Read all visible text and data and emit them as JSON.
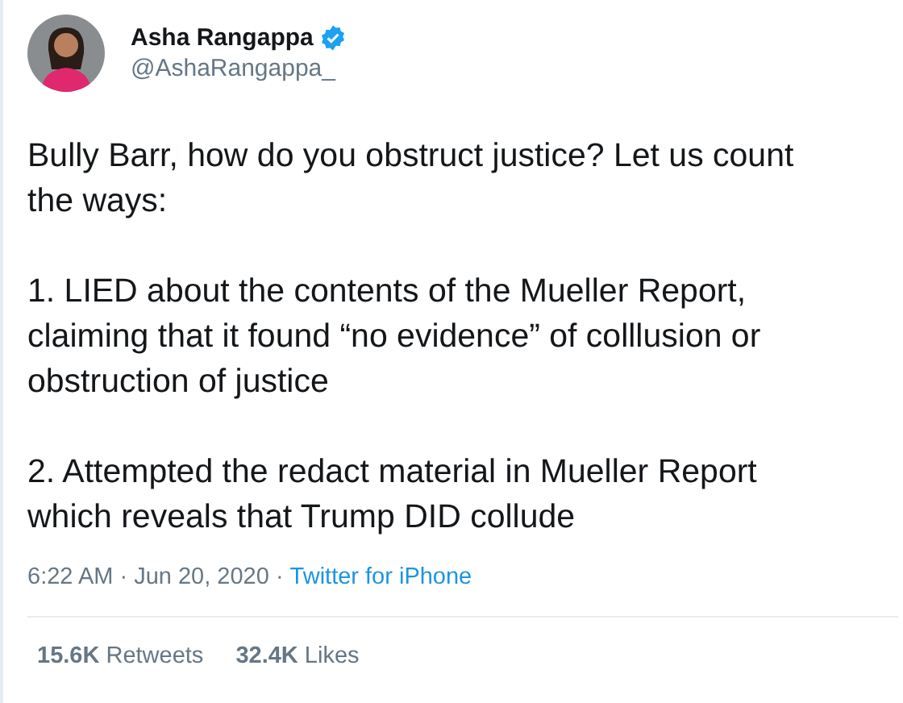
{
  "author": {
    "name": "Asha Rangappa",
    "verified": true,
    "handle": "@AshaRangappa_"
  },
  "tweet": {
    "paragraphs": [
      {
        "lines": [
          "Bully Barr, how do you obstruct justice? Let us count",
          "the ways:"
        ]
      },
      {
        "lines": [
          "1. LIED about the contents of the Mueller Report,",
          "claiming that it found “no evidence” of colllusion or",
          "obstruction of justice"
        ]
      },
      {
        "lines": [
          "2. Attempted the redact material in Mueller Report",
          "which reveals that Trump DID collude"
        ]
      }
    ]
  },
  "meta": {
    "timestamp": "6:22 AM · Jun 20, 2020 ·",
    "source": "Twitter for iPhone"
  },
  "stats": [
    "**15.6K** Retweets",
    "**32.4K** Likes"
  ]
}
